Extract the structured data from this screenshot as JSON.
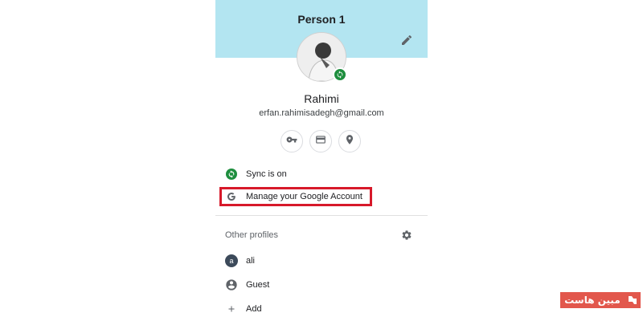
{
  "profile": {
    "title": "Person 1",
    "name": "Rahimi",
    "email": "erfan.rahimisadegh@gmail.com"
  },
  "quick_actions": [
    {
      "icon": "key-icon"
    },
    {
      "icon": "credit-card-icon"
    },
    {
      "icon": "location-pin-icon"
    }
  ],
  "menu": {
    "sync_label": "Sync is on",
    "manage_label": "Manage your Google Account"
  },
  "other_profiles": {
    "heading": "Other profiles",
    "items": [
      {
        "label": "ali",
        "avatar_letter": "a"
      },
      {
        "label": "Guest"
      },
      {
        "label": "Add"
      }
    ]
  },
  "watermark": {
    "text": "مبین هاست"
  },
  "colors": {
    "header_band": "#b3e5f1",
    "sync_green": "#1e8e3e",
    "highlight_red": "#d7192a",
    "watermark_red": "#e2574c"
  }
}
